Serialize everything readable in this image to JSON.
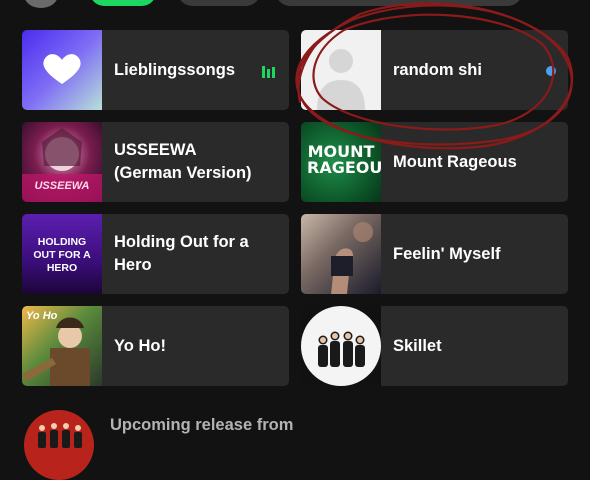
{
  "cards": [
    {
      "title": "Lieblingssongs",
      "thumb": "liked-songs-heart-icon",
      "indicator": "equalizer"
    },
    {
      "title": "random shi",
      "thumb": "default-user-silhouette",
      "indicator": "unread-dot"
    },
    {
      "title": "USSEEWA (German Version)",
      "thumb": "usseewa-cover",
      "thumb_text": "USSEEWA"
    },
    {
      "title": "Mount Rageous",
      "thumb": "mount-rageous-cover",
      "thumb_text": "MOUNT RAGEOUS"
    },
    {
      "title": "Holding Out for a Hero",
      "thumb": "holding-out-cover",
      "thumb_text": "HOLDING OUT FOR A HERO"
    },
    {
      "title": "Feelin' Myself",
      "thumb": "feelin-myself-cover"
    },
    {
      "title": "Yo Ho!",
      "thumb": "yo-ho-cover",
      "thumb_text": "Yo Ho"
    },
    {
      "title": "Skillet",
      "thumb": "skillet-band-photo"
    }
  ],
  "upcoming": {
    "label": "Upcoming release from"
  },
  "colors": {
    "background": "#121212",
    "card": "#2a2a2a",
    "accent": "#1ed760",
    "annotation": "#8b1a1a",
    "dot": "#4aa3f0"
  }
}
